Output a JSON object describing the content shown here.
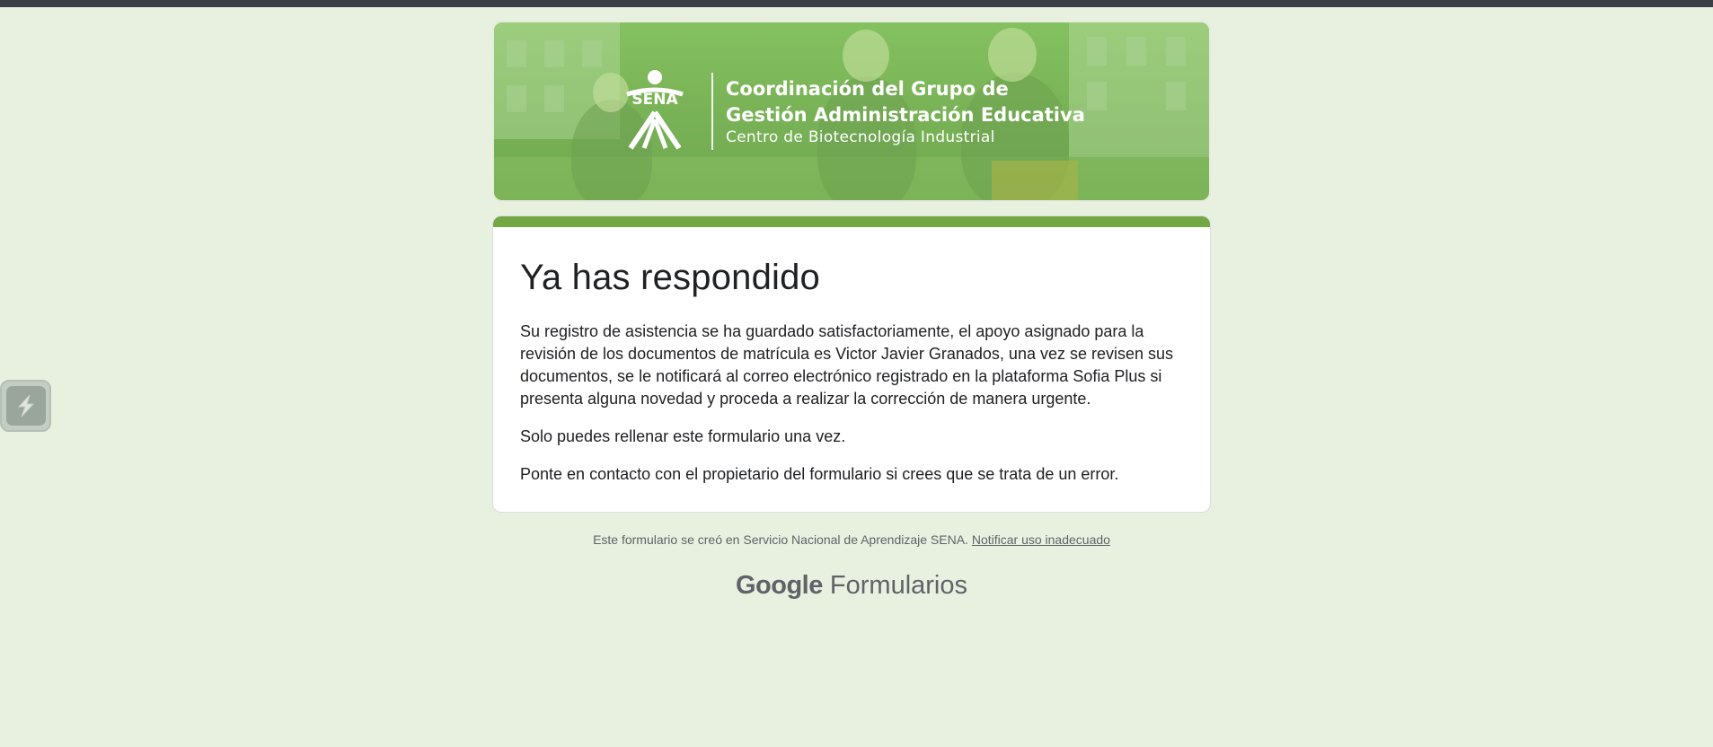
{
  "banner": {
    "logo_text": "SENA",
    "title_line1": "Coordinación del Grupo de",
    "title_line2": "Gestión Administración Educativa",
    "subtitle": "Centro de Biotecnología Industrial"
  },
  "card": {
    "title": "Ya has respondido",
    "message": "Su registro de asistencia se ha guardado satisfactoriamente, el apoyo asignado para la revisión de los documentos de matrícula es Victor Javier Granados, una vez se revisen sus documentos, se le notificará al correo electrónico registrado en la plataforma Sofia Plus si presenta alguna novedad y proceda a realizar la corrección de manera urgente.",
    "once_note": "Solo puedes rellenar este formulario una vez.",
    "contact_note": "Ponte en contacto con el propietario del formulario si crees que se trata de un error."
  },
  "footer": {
    "created_text": "Este formulario se creó en Servicio Nacional de Aprendizaje SENA.",
    "report_link": "Notificar uso inadecuado",
    "brand_google": "Google",
    "brand_forms": "Formularios"
  },
  "colors": {
    "page_bg": "#e8f0e0",
    "accent": "#72a844",
    "banner_green": "#7bb558"
  },
  "icons": {
    "floating_button": "extension-lightning-icon",
    "logo": "sena-logo"
  }
}
